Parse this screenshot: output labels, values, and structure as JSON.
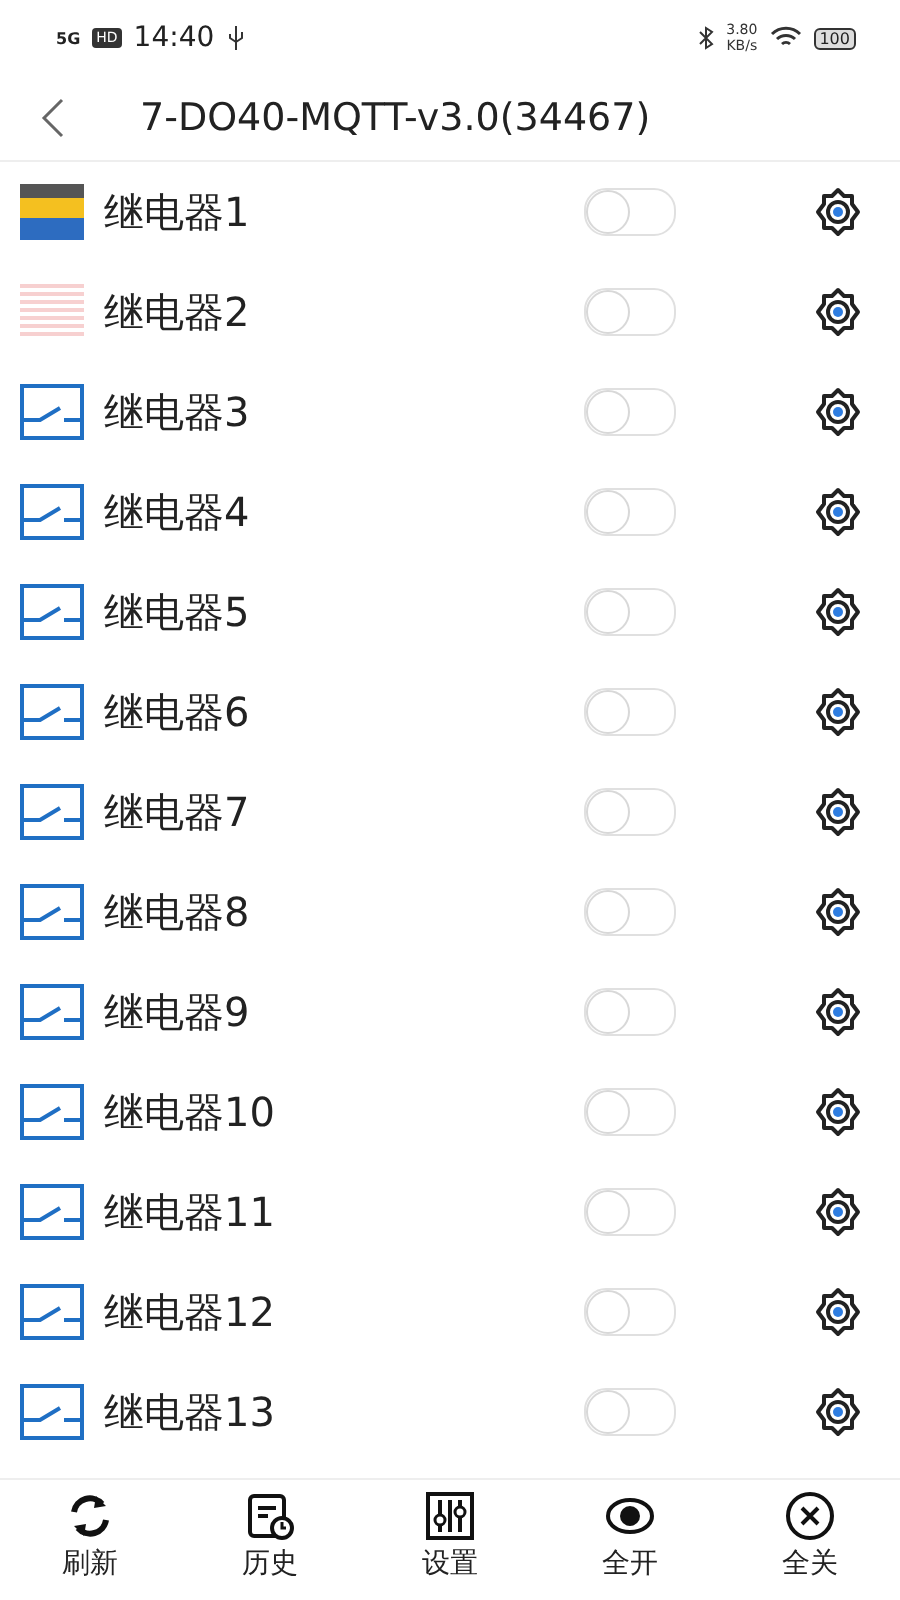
{
  "status_bar": {
    "network": "5G",
    "hd": "HD",
    "time": "14:40",
    "speed": "3.80",
    "speed_unit": "KB/s",
    "battery": "100"
  },
  "header": {
    "title": "7-DO40-MQTT-v3.0(34467)"
  },
  "relays": [
    {
      "kind": "photo",
      "name": "继电器1",
      "on": false
    },
    {
      "kind": "document",
      "name": "继电器2",
      "on": false
    },
    {
      "kind": "relay",
      "name": "继电器3",
      "on": false
    },
    {
      "kind": "relay",
      "name": "继电器4",
      "on": false
    },
    {
      "kind": "relay",
      "name": "继电器5",
      "on": false
    },
    {
      "kind": "relay",
      "name": "继电器6",
      "on": false
    },
    {
      "kind": "relay",
      "name": "继电器7",
      "on": false
    },
    {
      "kind": "relay",
      "name": "继电器8",
      "on": false
    },
    {
      "kind": "relay",
      "name": "继电器9",
      "on": false
    },
    {
      "kind": "relay",
      "name": "继电器10",
      "on": false
    },
    {
      "kind": "relay",
      "name": "继电器11",
      "on": false
    },
    {
      "kind": "relay",
      "name": "继电器12",
      "on": false
    },
    {
      "kind": "relay",
      "name": "继电器13",
      "on": false
    }
  ],
  "toolbar": [
    {
      "kind": "refresh",
      "label": "刷新"
    },
    {
      "kind": "history",
      "label": "历史"
    },
    {
      "kind": "settings",
      "label": "设置"
    },
    {
      "kind": "all_on",
      "label": "全开"
    },
    {
      "kind": "all_off",
      "label": "全关"
    }
  ]
}
